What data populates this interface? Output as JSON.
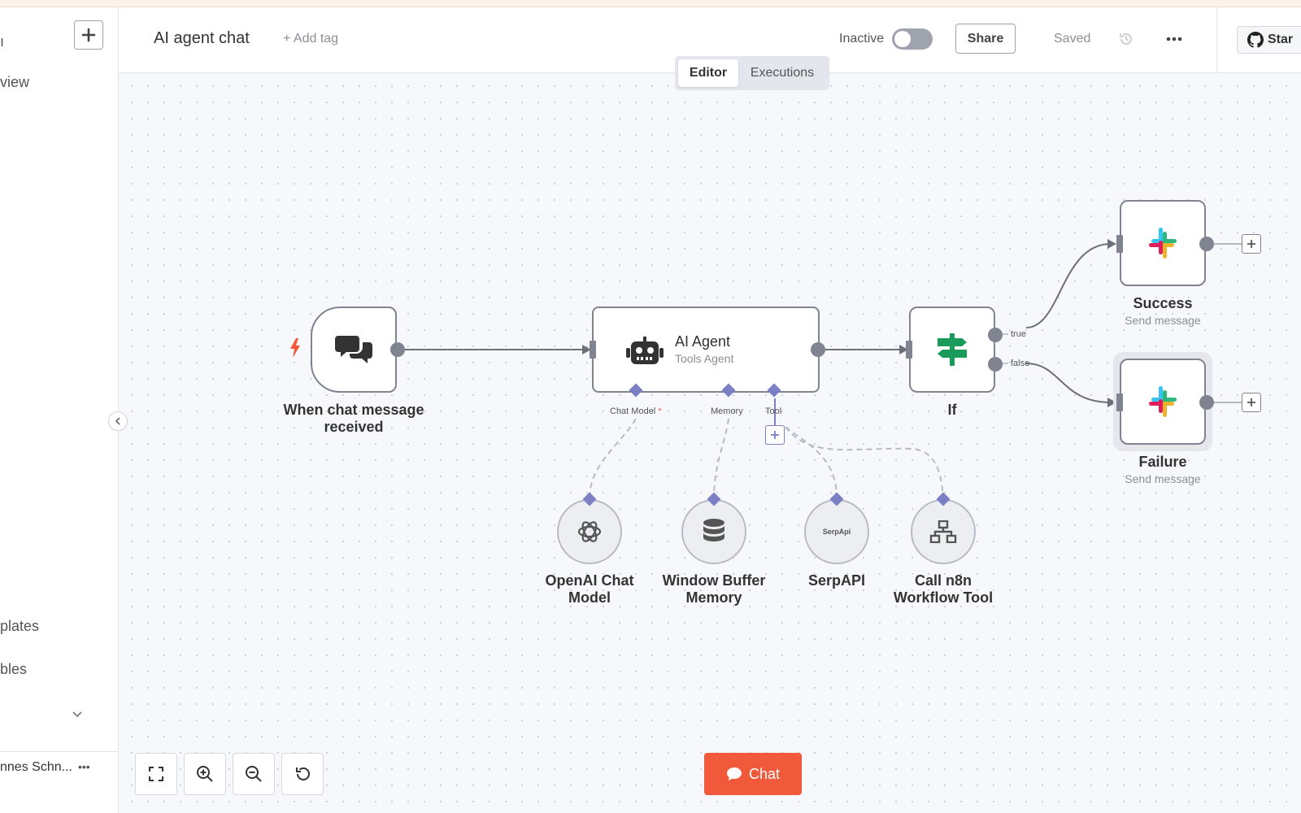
{
  "sidebar": {
    "partial_overview": "view",
    "partial_templates": "plates",
    "partial_variables": "bles",
    "partial_user": "nnes Schn...",
    "user_more": "•••"
  },
  "header": {
    "workflow_name": "AI agent chat",
    "add_tag": "+ Add tag",
    "status_label": "Inactive",
    "active": false,
    "share": "Share",
    "saved": "Saved",
    "more": "•••",
    "star": "Star"
  },
  "tabs": {
    "editor": "Editor",
    "executions": "Executions",
    "active": "Editor"
  },
  "nodes": {
    "trigger": {
      "name_line1": "When chat message",
      "name_line2": "received"
    },
    "agent": {
      "name": "AI Agent",
      "subtitle": "Tools Agent",
      "ports": {
        "chat_model": "Chat Model",
        "required_mark": "*",
        "memory": "Memory",
        "tool": "Tool"
      }
    },
    "if": {
      "name": "If",
      "outputs": {
        "true": "true",
        "false": "false"
      }
    },
    "success": {
      "name": "Success",
      "subtitle": "Send message"
    },
    "failure": {
      "name": "Failure",
      "subtitle": "Send message"
    },
    "openai": {
      "name_line1": "OpenAI Chat",
      "name_line2": "Model"
    },
    "memory": {
      "name_line1": "Window Buffer",
      "name_line2": "Memory"
    },
    "serpapi": {
      "name": "SerpAPI",
      "logo_text": "SerpApi"
    },
    "n8n_tool": {
      "name_line1": "Call n8n",
      "name_line2": "Workflow Tool"
    }
  },
  "canvas_controls": {
    "chat": "Chat"
  },
  "colors": {
    "accent": "#f05a3a",
    "port_purple": "#7b7fc4",
    "if_green": "#1a9b5a",
    "slack": [
      "#36c5f0",
      "#2eb67d",
      "#ecb22e",
      "#e01e5a"
    ]
  },
  "icons": [
    "plus-icon",
    "chevron-left-icon",
    "chevron-down-icon",
    "history-icon",
    "more-icon",
    "github-icon",
    "lightning-icon",
    "chat-bubbles-icon",
    "robot-icon",
    "signpost-icon",
    "slack-icon",
    "openai-icon",
    "database-icon",
    "serpapi-icon",
    "sitemap-icon",
    "fit-view-icon",
    "zoom-in-icon",
    "zoom-out-icon",
    "reset-zoom-icon"
  ]
}
